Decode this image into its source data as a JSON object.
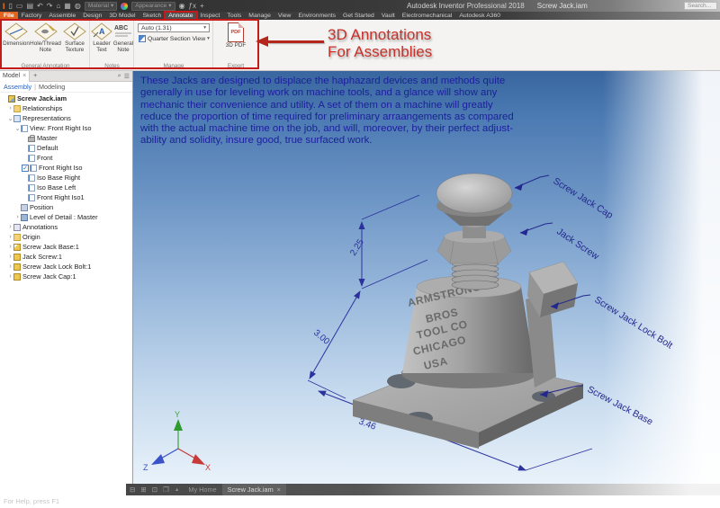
{
  "window": {
    "app_title": "Autodesk Inventor Professional 2018",
    "doc_title": "Screw Jack.iam",
    "search_placeholder": "Search...",
    "material_label": "Material",
    "appearance_label": "Appearance"
  },
  "menu_tabs": [
    "File",
    "Factory",
    "Assemble",
    "Design",
    "3D Model",
    "Sketch",
    "Annotate",
    "Inspect",
    "Tools",
    "Manage",
    "View",
    "Environments",
    "Get Started",
    "Vault",
    "Electromechanical",
    "Autodesk A360"
  ],
  "ribbon": {
    "dimension": "Dimension",
    "hole_thread_1": "Hole/Thread",
    "hole_thread_2": "Note",
    "surface_1": "Surface",
    "surface_2": "Texture",
    "leader_1": "Leader",
    "leader_2": "Text",
    "general_1": "General",
    "general_2": "Note",
    "icon_a": "A",
    "icon_abc": "ABC",
    "icon_pdf": "PDF",
    "scale_combo": "Auto (1.31)",
    "quarter_section": "Quarter Section View",
    "pdf_button": "3D PDF",
    "group_general": "General Annotation",
    "group_notes": "Notes",
    "group_manage": "Manage",
    "group_export": "Export"
  },
  "callout": {
    "line1": "3D Annotations",
    "line2": "For Assemblies"
  },
  "browser": {
    "tab_model": "Model",
    "mode_assembly": "Assembly",
    "mode_sep": "|",
    "mode_modeling": "Modeling",
    "tree": [
      {
        "label": "Screw Jack.iam"
      },
      {
        "label": "Relationships"
      },
      {
        "label": "Representations"
      },
      {
        "label": "View: Front Right Iso"
      },
      {
        "label": "Master"
      },
      {
        "label": "Default"
      },
      {
        "label": "Front"
      },
      {
        "label": "Front Right Iso"
      },
      {
        "label": "Iso Base Right"
      },
      {
        "label": "Iso Base Left"
      },
      {
        "label": "Front Right Iso1"
      },
      {
        "label": "Position"
      },
      {
        "label": "Level of Detail : Master"
      },
      {
        "label": "Annotations"
      },
      {
        "label": "Origin"
      },
      {
        "label": "Screw Jack Base:1"
      },
      {
        "label": "Jack Screw:1"
      },
      {
        "label": "Screw Jack Lock Bolt:1"
      },
      {
        "label": "Screw Jack Cap:1"
      }
    ]
  },
  "viewport": {
    "paragraph": [
      "These Jacks are designed to displace the haphazard devices and methods quite",
      "generally in use for leveling work on machine tools, and a glance will show any",
      "mechanic their convenience and utility.  A set of them on a machine will greatly",
      "reduce the proportion of time required for preliminary arraangements as compared",
      "with the actual machine time on the job, and will, moreover, by their perfect adjust-",
      "ability and solidity, insure good, true surfaced work."
    ],
    "dimensions": {
      "height": "2.25",
      "width": "3.00",
      "base": "3.46"
    },
    "part_labels": [
      "Screw Jack Cap",
      "Jack Screw",
      "Screw Jack Lock Bolt",
      "Screw Jack Base"
    ],
    "engraving": [
      "ARMSTRONG",
      "BROS",
      "TOOL CO",
      "CHICAGO",
      "USA"
    ],
    "axes": {
      "x": "X",
      "y": "Y",
      "z": "Z"
    }
  },
  "bottom": {
    "home_tab": "My Home",
    "doc_tab": "Screw Jack.iam",
    "status": "For Help, press F1"
  },
  "icons": {
    "search": "⌕",
    "menu": "☰",
    "dropdown": "▾",
    "close": "×",
    "tab_add": "+",
    "expand": "›",
    "collapse": "⌄",
    "check": "✓",
    "win_cascade": "⊟",
    "win_tile": "⊞",
    "win_arrange": "⊡",
    "win_switch": "❒",
    "up": "▲",
    "qat_new": "▯",
    "qat_open": "▭",
    "qat_save": "▤",
    "qat_undo": "↶",
    "qat_redo": "↷",
    "qat_home": "⌂",
    "qat_screen": "▦",
    "qat_globe": "◍",
    "qat_pin": "◉",
    "qat_fx": "ƒx",
    "qat_plus": "+"
  },
  "colors": {
    "accent_red": "#c41a1a",
    "viewport_blue": "#39669f",
    "annotation_blue": "#23278f",
    "file_tab_orange": "#e0641e"
  }
}
